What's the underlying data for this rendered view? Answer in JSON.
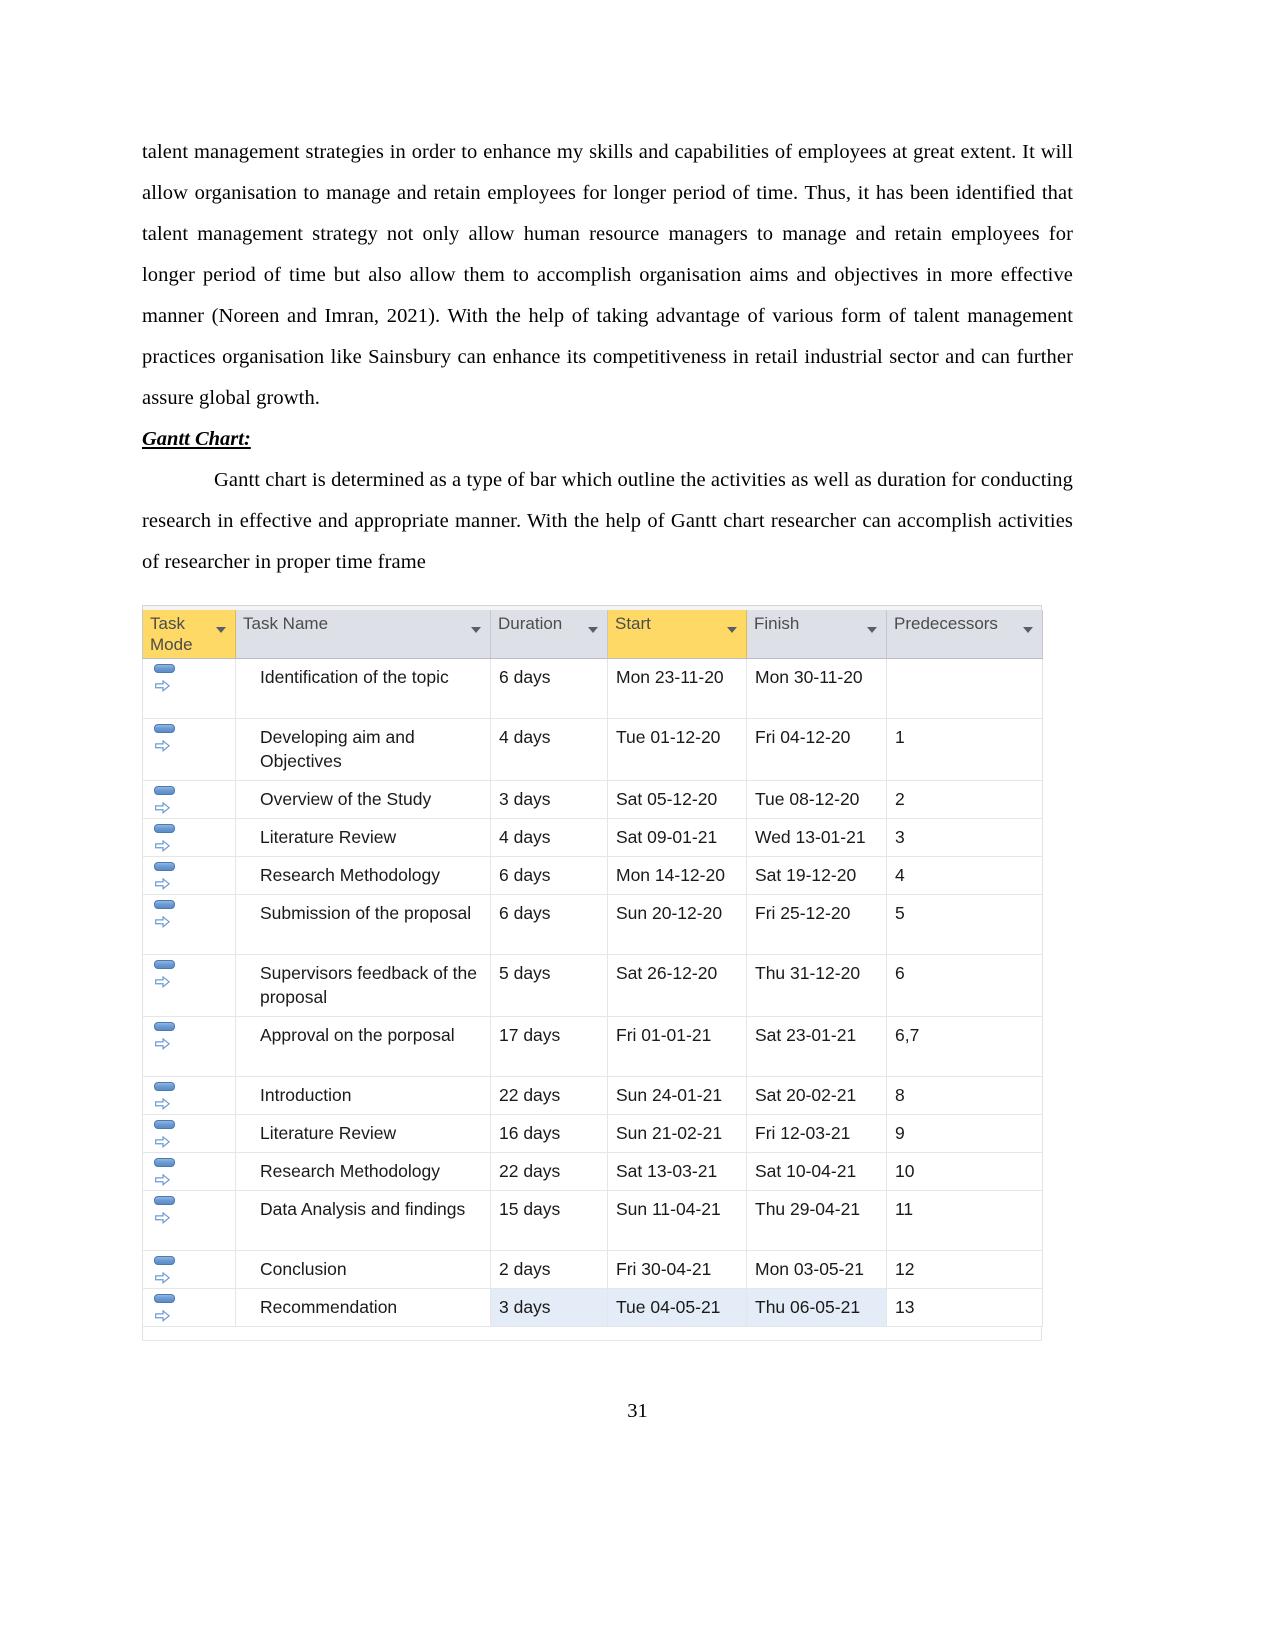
{
  "document": {
    "paragraphs": [
      "talent management strategies in order to enhance my skills and capabilities of employees at great extent. It will allow organisation to manage and retain employees for longer period of time. Thus, it has been identified that talent management strategy not only allow human resource managers to manage and retain employees for longer period of time but also allow them to accomplish organisation aims and objectives in more effective manner (Noreen and Imran, 2021). With the help of taking advantage of various form of talent management practices organisation like Sainsbury can enhance its competitiveness in retail industrial sector and can further assure global growth.",
      "Gantt chart is determined as a type of bar which outline the activities as well as duration for conducting research in effective and appropriate manner. With the help of Gantt chart researcher can accomplish activities of researcher in proper time frame"
    ],
    "heading": "Gantt Chart:",
    "page_number": "31"
  },
  "colors": {
    "header_background": "#dde1e7",
    "header_highlight": "#ffd966",
    "header_text": "#4c4c4c",
    "row_selection": "#e4ecf7",
    "grid_line": "#e3e6ea",
    "task_mode_icon": "#6d9bd1"
  },
  "chart_data": {
    "type": "table",
    "title": "Gantt Chart project task schedule",
    "columns": [
      {
        "label": "Task Mode",
        "highlighted": true,
        "filter": true
      },
      {
        "label": "Task Name",
        "highlighted": false,
        "filter": true
      },
      {
        "label": "Duration",
        "highlighted": false,
        "filter": true
      },
      {
        "label": "Start",
        "highlighted": true,
        "filter": true
      },
      {
        "label": "Finish",
        "highlighted": false,
        "filter": true
      },
      {
        "label": "Predecessors",
        "highlighted": false,
        "filter": true
      }
    ],
    "rows": [
      {
        "id": 1,
        "mode_icon": "auto-scheduled-icon",
        "name": "Identification of the topic",
        "duration": "6 days",
        "start": "Mon 23-11-20",
        "finish": "Mon 30-11-20",
        "predecessors": "",
        "tall": true,
        "selected": false
      },
      {
        "id": 2,
        "mode_icon": "auto-scheduled-icon",
        "name": "Developing aim and Objectives",
        "duration": "4 days",
        "start": "Tue 01-12-20",
        "finish": "Fri 04-12-20",
        "predecessors": "1",
        "tall": true,
        "selected": false
      },
      {
        "id": 3,
        "mode_icon": "auto-scheduled-icon",
        "name": "Overview of the Study",
        "duration": "3 days",
        "start": "Sat 05-12-20",
        "finish": "Tue 08-12-20",
        "predecessors": "2",
        "tall": false,
        "selected": false
      },
      {
        "id": 4,
        "mode_icon": "auto-scheduled-icon",
        "name": "Literature Review",
        "duration": "4 days",
        "start": "Sat 09-01-21",
        "finish": "Wed 13-01-21",
        "predecessors": "3",
        "tall": false,
        "selected": false
      },
      {
        "id": 5,
        "mode_icon": "auto-scheduled-icon",
        "name": "Research Methodology",
        "duration": "6 days",
        "start": "Mon 14-12-20",
        "finish": "Sat 19-12-20",
        "predecessors": "4",
        "tall": false,
        "selected": false
      },
      {
        "id": 6,
        "mode_icon": "auto-scheduled-icon",
        "name": "Submission of the proposal",
        "duration": "6 days",
        "start": "Sun 20-12-20",
        "finish": "Fri 25-12-20",
        "predecessors": "5",
        "tall": true,
        "selected": false
      },
      {
        "id": 7,
        "mode_icon": "auto-scheduled-icon",
        "name": "Supervisors feedback of the proposal",
        "duration": "5 days",
        "start": "Sat 26-12-20",
        "finish": "Thu 31-12-20",
        "predecessors": "6",
        "tall": true,
        "selected": false
      },
      {
        "id": 8,
        "mode_icon": "auto-scheduled-icon",
        "name": "Approval on the porposal",
        "duration": "17 days",
        "start": "Fri 01-01-21",
        "finish": "Sat 23-01-21",
        "predecessors": "6,7",
        "tall": true,
        "selected": false
      },
      {
        "id": 9,
        "mode_icon": "auto-scheduled-icon",
        "name": "Introduction",
        "duration": "22 days",
        "start": "Sun 24-01-21",
        "finish": "Sat 20-02-21",
        "predecessors": "8",
        "tall": false,
        "selected": false
      },
      {
        "id": 10,
        "mode_icon": "auto-scheduled-icon",
        "name": "Literature Review",
        "duration": "16 days",
        "start": "Sun 21-02-21",
        "finish": "Fri 12-03-21",
        "predecessors": "9",
        "tall": false,
        "selected": false
      },
      {
        "id": 11,
        "mode_icon": "auto-scheduled-icon",
        "name": "Research Methodology",
        "duration": "22 days",
        "start": "Sat 13-03-21",
        "finish": "Sat 10-04-21",
        "predecessors": "10",
        "tall": false,
        "selected": false
      },
      {
        "id": 12,
        "mode_icon": "auto-scheduled-icon",
        "name": "Data Analysis and findings",
        "duration": "15 days",
        "start": "Sun 11-04-21",
        "finish": "Thu 29-04-21",
        "predecessors": "11",
        "tall": true,
        "selected": false
      },
      {
        "id": 13,
        "mode_icon": "auto-scheduled-icon",
        "name": "Conclusion",
        "duration": "2 days",
        "start": "Fri 30-04-21",
        "finish": "Mon 03-05-21",
        "predecessors": "12",
        "tall": false,
        "selected": false
      },
      {
        "id": 14,
        "mode_icon": "auto-scheduled-icon",
        "name": "Recommendation",
        "duration": "3 days",
        "start": "Tue 04-05-21",
        "finish": "Thu 06-05-21",
        "predecessors": "13",
        "tall": false,
        "selected": true
      }
    ]
  }
}
